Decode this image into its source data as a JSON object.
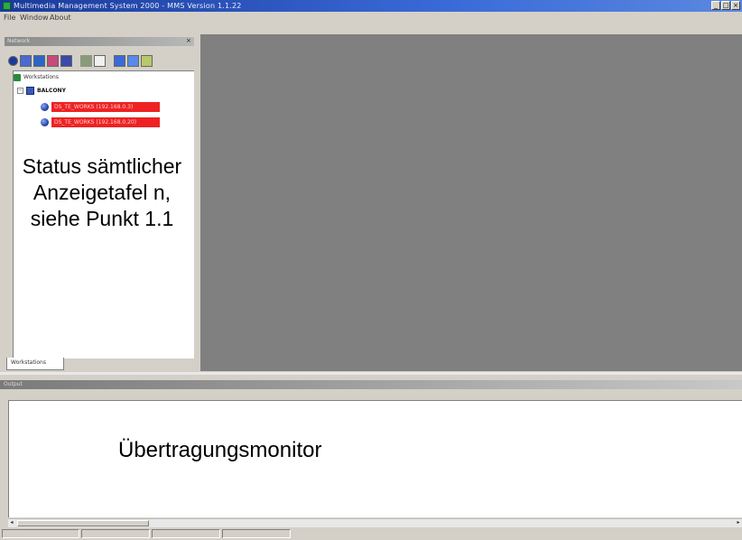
{
  "window": {
    "title": "Multimedia Management System 2000 - MMS Version 1.1.22",
    "controls": {
      "minimize": "_",
      "maximize": "□",
      "close": "×"
    }
  },
  "menu": {
    "items": [
      "File",
      "Window",
      "About"
    ]
  },
  "left_panel": {
    "caption": "Network",
    "toolbar_icons": [
      "connect-icon",
      "text-icon",
      "upload-icon",
      "image-icon",
      "video-icon",
      "settings-icon",
      "window-icon",
      "info-icon",
      "help-icon",
      "refresh-icon"
    ],
    "tree": {
      "root_label": "Workstations",
      "group_label": "BALCONY",
      "devices": [
        "DS_TE_WORKS (192.168.0.3)",
        "DS_TE_WORKS (192.168.0.20)"
      ]
    },
    "status_note": "Status sämtlicher Anzeigetafel n, siehe Punkt 1.1",
    "tab_label": "Workstations"
  },
  "output_panel": {
    "caption": "Output",
    "monitor_note": "Übertragungsmonitor"
  },
  "colors": {
    "titlebar_start": "#1a3a9a",
    "device_highlight": "#ee2222",
    "workspace": "#808080",
    "chrome": "#d4d0c8"
  }
}
